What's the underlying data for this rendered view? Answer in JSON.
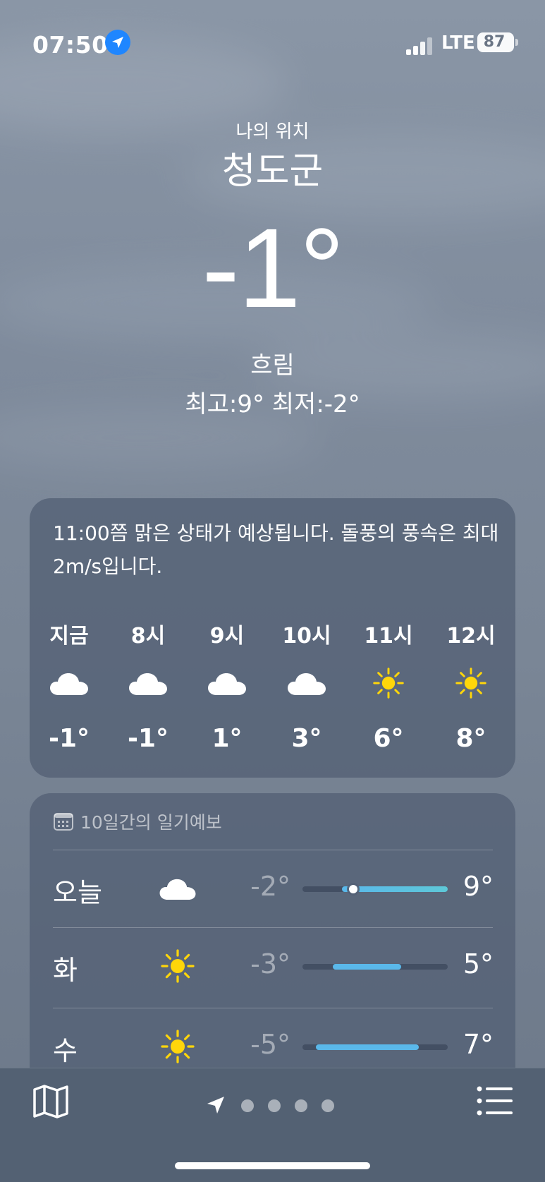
{
  "status_bar": {
    "time": "07:50",
    "network": "LTE",
    "battery": "87"
  },
  "location": {
    "label": "나의 위치",
    "city": "청도군"
  },
  "current": {
    "temp": "-1°",
    "condition": "흐림",
    "hilo": "최고:9°  최저:-2°"
  },
  "hourly": {
    "summary": "11:00쯤 맑은 상태가 예상됩니다. 돌풍의 풍속은 최대 2m/s입니다.",
    "items": [
      {
        "time": "지금",
        "icon": "cloud-icon",
        "temp": "-1°"
      },
      {
        "time": "8시",
        "icon": "cloud-icon",
        "temp": "-1°"
      },
      {
        "time": "9시",
        "icon": "cloud-icon",
        "temp": "1°"
      },
      {
        "time": "10시",
        "icon": "cloud-icon",
        "temp": "3°"
      },
      {
        "time": "11시",
        "icon": "sun-icon",
        "temp": "6°"
      },
      {
        "time": "12시",
        "icon": "sun-icon",
        "temp": "8°"
      }
    ]
  },
  "daily": {
    "title": "10일간의 일기예보",
    "rows": [
      {
        "day": "오늘",
        "icon": "cloud-icon",
        "low": "-2°",
        "high": "9°",
        "range_start": 0.27,
        "range_end": 1.0,
        "current_marker": 0.35
      },
      {
        "day": "화",
        "icon": "sun-icon",
        "low": "-3°",
        "high": "5°",
        "range_start": 0.21,
        "range_end": 0.68
      },
      {
        "day": "수",
        "icon": "sun-icon",
        "low": "-5°",
        "high": "7°",
        "range_start": 0.09,
        "range_end": 0.8
      }
    ]
  },
  "colors": {
    "sun": "#ffd60a",
    "range_warm": "#5ec8d8",
    "range_cool": "#5ab8ea"
  },
  "tabbar": {
    "page_count": 4
  }
}
